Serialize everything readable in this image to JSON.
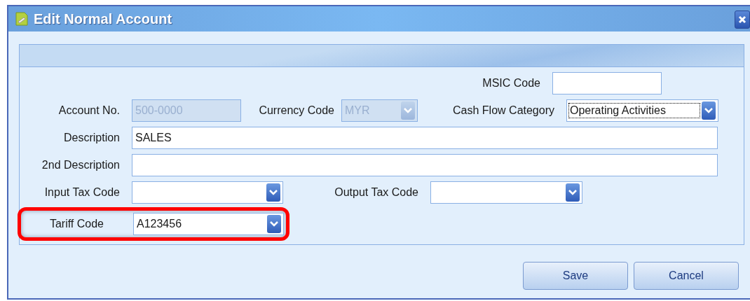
{
  "window": {
    "title": "Edit Normal Account"
  },
  "fields": {
    "msic_code": {
      "label": "MSIC Code",
      "disabled": false,
      "focused": false
    },
    "account_no": {
      "label": "Account No.",
      "value": "500-0000",
      "disabled": true,
      "focused": false
    },
    "currency_code": {
      "label": "Currency Code",
      "value": "MYR",
      "disabled": true,
      "focused": false
    },
    "cash_flow_category": {
      "label": "Cash Flow Category",
      "value": "Operating Activities",
      "disabled": false,
      "focused": true
    },
    "description": {
      "label": "Description",
      "value": "SALES",
      "disabled": false,
      "focused": false
    },
    "second_description": {
      "label": "2nd Description",
      "disabled": false,
      "focused": false
    },
    "input_tax_code": {
      "label": "Input Tax Code",
      "disabled": false,
      "focused": false
    },
    "output_tax_code": {
      "label": "Output Tax Code",
      "disabled": false,
      "focused": false
    },
    "tariff_code": {
      "label": "Tariff Code",
      "value": "A123456",
      "disabled": false,
      "focused": false,
      "highlighted": true
    }
  },
  "buttons": [
    {
      "label": "Save"
    },
    {
      "label": "Cancel"
    }
  ]
}
